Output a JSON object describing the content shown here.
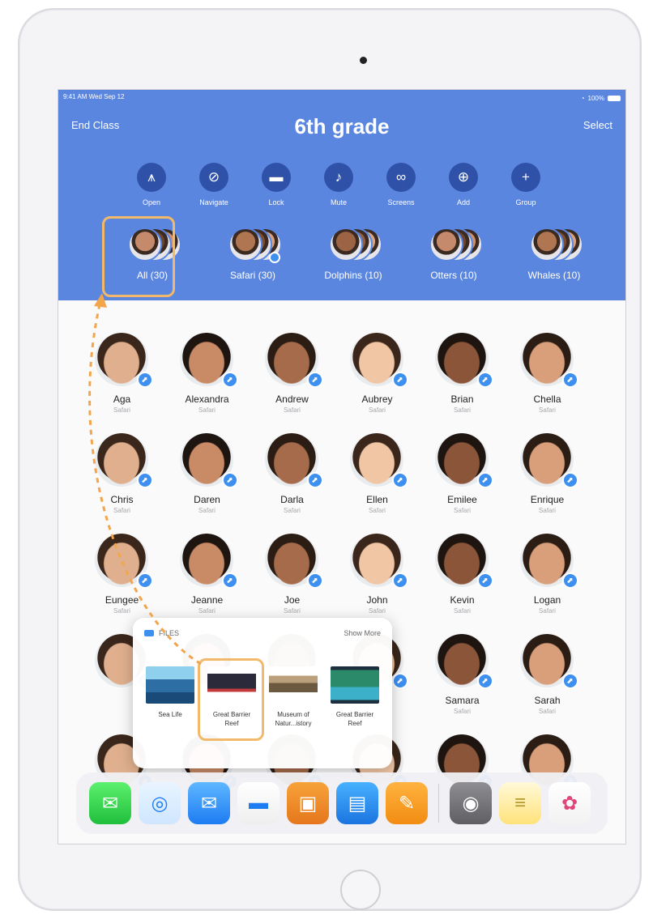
{
  "status": {
    "time": "9:41 AM",
    "date": "Wed Sep 12",
    "battery": "100%"
  },
  "header": {
    "left_label": "End Class",
    "title": "6th grade",
    "right_label": "Select"
  },
  "actions": [
    {
      "label": "Open",
      "icon": "app-store-icon",
      "glyph": "⩚"
    },
    {
      "label": "Navigate",
      "icon": "compass-icon",
      "glyph": "⊘"
    },
    {
      "label": "Lock",
      "icon": "lock-icon",
      "glyph": "▬"
    },
    {
      "label": "Mute",
      "icon": "bell-mute-icon",
      "glyph": "♪"
    },
    {
      "label": "Screens",
      "icon": "binoculars-icon",
      "glyph": "∞"
    },
    {
      "label": "Add",
      "icon": "add-person-icon",
      "glyph": "⊕"
    },
    {
      "label": "Group",
      "icon": "plus-icon",
      "glyph": "+"
    }
  ],
  "groups": [
    {
      "label": "All (30)",
      "badge": false
    },
    {
      "label": "Safari (30)",
      "badge": true
    },
    {
      "label": "Dolphins (10)",
      "badge": false
    },
    {
      "label": "Otters (10)",
      "badge": false
    },
    {
      "label": "Whales (10)",
      "badge": false
    }
  ],
  "students": [
    {
      "name": "Aga",
      "app": "Safari"
    },
    {
      "name": "Alexandra",
      "app": "Safari"
    },
    {
      "name": "Andrew",
      "app": "Safari"
    },
    {
      "name": "Aubrey",
      "app": "Safari"
    },
    {
      "name": "Brian",
      "app": "Safari"
    },
    {
      "name": "Chella",
      "app": "Safari"
    },
    {
      "name": "Chris",
      "app": "Safari"
    },
    {
      "name": "Daren",
      "app": "Safari"
    },
    {
      "name": "Darla",
      "app": "Safari"
    },
    {
      "name": "Ellen",
      "app": "Safari"
    },
    {
      "name": "Emilee",
      "app": "Safari"
    },
    {
      "name": "Enrique",
      "app": "Safari"
    },
    {
      "name": "Eungee",
      "app": "Safari"
    },
    {
      "name": "Jeanne",
      "app": "Safari"
    },
    {
      "name": "Joe",
      "app": "Safari"
    },
    {
      "name": "John",
      "app": "Safari"
    },
    {
      "name": "Kevin",
      "app": "Safari"
    },
    {
      "name": "Logan",
      "app": "Safari"
    },
    {
      "name": "",
      "app": ""
    },
    {
      "name": "",
      "app": ""
    },
    {
      "name": "",
      "app": ""
    },
    {
      "name": "",
      "app": ""
    },
    {
      "name": "Samara",
      "app": "Safari"
    },
    {
      "name": "Sarah",
      "app": "Safari"
    },
    {
      "name": "",
      "app": ""
    },
    {
      "name": "",
      "app": ""
    },
    {
      "name": "",
      "app": ""
    },
    {
      "name": "",
      "app": ""
    },
    {
      "name": "",
      "app": ""
    },
    {
      "name": "",
      "app": ""
    }
  ],
  "files_popup": {
    "title": "FILES",
    "show_more": "Show More",
    "items": [
      {
        "label": "Sea Life"
      },
      {
        "label": "Great Barrier\nReef"
      },
      {
        "label": "Museum of\nNatur...istory"
      },
      {
        "label": "Great Barrier\nReef"
      }
    ]
  },
  "dock": [
    {
      "name": "Messages",
      "icon": "messages-icon"
    },
    {
      "name": "Safari",
      "icon": "safari-icon"
    },
    {
      "name": "Mail",
      "icon": "mail-icon"
    },
    {
      "name": "Files",
      "icon": "files-icon"
    },
    {
      "name": "Keynote-like app",
      "icon": "presentation-icon"
    },
    {
      "name": "Keynote",
      "icon": "keynote-icon"
    },
    {
      "name": "Pages",
      "icon": "pages-icon"
    },
    {
      "name": "Camera",
      "icon": "camera-icon"
    },
    {
      "name": "Notes",
      "icon": "notes-icon"
    },
    {
      "name": "Photos",
      "icon": "photos-icon"
    }
  ],
  "colors": {
    "header": "#5b86e0",
    "accent": "#3d8ff0",
    "highlight": "#f2b96b"
  }
}
